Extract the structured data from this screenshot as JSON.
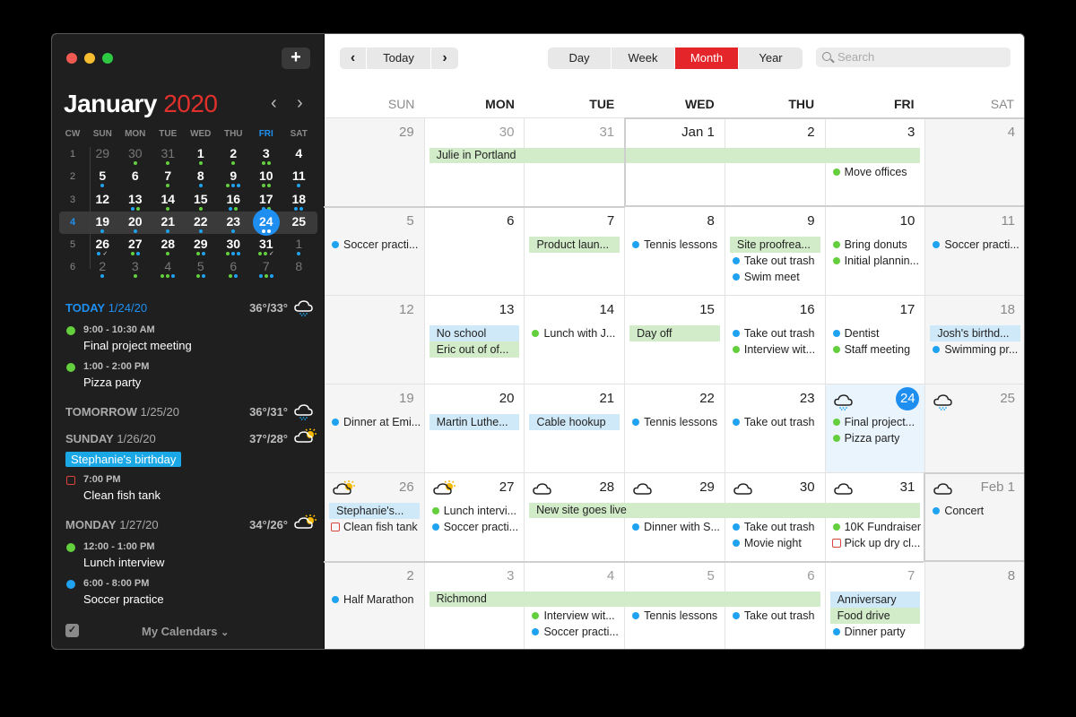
{
  "colors": {
    "green": "#63cf3d",
    "blue": "#1fa2ef",
    "red": "#e4262a",
    "accent": "#1e8ff0"
  },
  "sidebar": {
    "add_label": "+",
    "month": "January",
    "year": "2020",
    "prev": "‹",
    "next": "›",
    "mini_headers": [
      "CW",
      "SUN",
      "MON",
      "TUE",
      "WED",
      "THU",
      "FRI",
      "SAT"
    ],
    "mini_weeks": [
      {
        "cw": "1",
        "days": [
          {
            "n": "29",
            "dim": true,
            "dots": []
          },
          {
            "n": "30",
            "dim": true,
            "dots": [
              "g"
            ]
          },
          {
            "n": "31",
            "dim": true,
            "dots": [
              "g"
            ]
          },
          {
            "n": "1",
            "dots": [
              "g"
            ]
          },
          {
            "n": "2",
            "dots": [
              "g"
            ]
          },
          {
            "n": "3",
            "dots": [
              "g",
              "g"
            ]
          },
          {
            "n": "4",
            "dots": []
          }
        ]
      },
      {
        "cw": "2",
        "days": [
          {
            "n": "5",
            "dots": [
              "b"
            ]
          },
          {
            "n": "6",
            "dots": []
          },
          {
            "n": "7",
            "dots": [
              "g"
            ]
          },
          {
            "n": "8",
            "dots": [
              "b"
            ]
          },
          {
            "n": "9",
            "dots": [
              "g",
              "b",
              "b"
            ]
          },
          {
            "n": "10",
            "dots": [
              "g",
              "g"
            ]
          },
          {
            "n": "11",
            "dots": [
              "b"
            ]
          }
        ]
      },
      {
        "cw": "3",
        "days": [
          {
            "n": "12",
            "dots": []
          },
          {
            "n": "13",
            "dots": [
              "b",
              "g"
            ]
          },
          {
            "n": "14",
            "dots": [
              "g"
            ]
          },
          {
            "n": "15",
            "dots": [
              "g"
            ]
          },
          {
            "n": "16",
            "dots": [
              "b",
              "g"
            ]
          },
          {
            "n": "17",
            "dots": [
              "b",
              "g"
            ]
          },
          {
            "n": "18",
            "dots": [
              "b",
              "b"
            ]
          }
        ]
      },
      {
        "cw": "4",
        "current": true,
        "days": [
          {
            "n": "19",
            "dots": [
              "b"
            ]
          },
          {
            "n": "20",
            "dots": [
              "b"
            ]
          },
          {
            "n": "21",
            "dots": [
              "b"
            ]
          },
          {
            "n": "22",
            "dots": [
              "b"
            ]
          },
          {
            "n": "23",
            "dots": [
              "b"
            ]
          },
          {
            "n": "24",
            "today": true,
            "dots": [
              "w",
              "w"
            ]
          },
          {
            "n": "25",
            "dots": []
          }
        ]
      },
      {
        "cw": "5",
        "days": [
          {
            "n": "26",
            "dots": [
              "b",
              "c"
            ]
          },
          {
            "n": "27",
            "dots": [
              "g",
              "b"
            ]
          },
          {
            "n": "28",
            "dots": [
              "g"
            ]
          },
          {
            "n": "29",
            "dots": [
              "g",
              "b"
            ]
          },
          {
            "n": "30",
            "dots": [
              "g",
              "b",
              "b"
            ]
          },
          {
            "n": "31",
            "dots": [
              "g",
              "g",
              "c"
            ]
          },
          {
            "n": "1",
            "dim": true,
            "dots": [
              "b"
            ]
          }
        ]
      },
      {
        "cw": "6",
        "days": [
          {
            "n": "2",
            "dim": true,
            "dots": [
              "b"
            ]
          },
          {
            "n": "3",
            "dim": true,
            "dots": [
              "g"
            ]
          },
          {
            "n": "4",
            "dim": true,
            "dots": [
              "g",
              "g",
              "b"
            ]
          },
          {
            "n": "5",
            "dim": true,
            "dots": [
              "g",
              "b"
            ]
          },
          {
            "n": "6",
            "dim": true,
            "dots": [
              "g",
              "b"
            ]
          },
          {
            "n": "7",
            "dim": true,
            "dots": [
              "b",
              "g",
              "b"
            ]
          },
          {
            "n": "8",
            "dim": true,
            "dots": []
          }
        ]
      }
    ],
    "agenda": [
      {
        "label_bold": "TODAY",
        "label_date": "1/24/20",
        "today": true,
        "temp": "36°/33°",
        "weather": "rain-cloud-icon",
        "items": [
          {
            "type": "dot",
            "color": "green",
            "time": "9:00 - 10:30 AM",
            "title": "Final project meeting"
          },
          {
            "type": "dot",
            "color": "green",
            "time": "1:00 - 2:00 PM",
            "title": "Pizza party"
          }
        ]
      },
      {
        "label_bold": "TOMORROW",
        "label_date": "1/25/20",
        "temp": "36°/31°",
        "weather": "rain-cloud-icon",
        "items": []
      },
      {
        "label_bold": "SUNDAY",
        "label_date": "1/26/20",
        "temp": "37°/28°",
        "weather": "partly-sunny-icon",
        "allday": "Stephanie's birthday",
        "items": [
          {
            "type": "task",
            "time": "7:00 PM",
            "title": "Clean fish tank"
          }
        ]
      },
      {
        "label_bold": "MONDAY",
        "label_date": "1/27/20",
        "temp": "34°/26°",
        "weather": "partly-sunny-icon",
        "items": [
          {
            "type": "dot",
            "color": "green",
            "time": "12:00 - 1:00 PM",
            "title": "Lunch interview"
          },
          {
            "type": "dot",
            "color": "blue",
            "time": "6:00 - 8:00 PM",
            "title": "Soccer practice"
          }
        ]
      }
    ],
    "calendars_label": "My Calendars",
    "calendars_chevron": "⌄",
    "check": "✓"
  },
  "toolbar": {
    "prev": "‹",
    "today": "Today",
    "next": "›",
    "views": [
      "Day",
      "Week",
      "Month",
      "Year"
    ],
    "active_view": "Month",
    "search_placeholder": "Search"
  },
  "weekdays": [
    "SUN",
    "MON",
    "TUE",
    "WED",
    "THU",
    "FRI",
    "SAT"
  ],
  "weeks": [
    {
      "spans": [
        {
          "title": "Julie in Portland",
          "start": 1,
          "end": 5,
          "row": 0
        }
      ],
      "days": [
        {
          "num": "29",
          "out": true,
          "events": []
        },
        {
          "num": "30",
          "out": true,
          "events": [
            {
              "type": "gap"
            }
          ]
        },
        {
          "num": "31",
          "out": true,
          "events": [
            {
              "type": "gap"
            }
          ]
        },
        {
          "num": "Jan 1",
          "events": [
            {
              "type": "gap"
            }
          ]
        },
        {
          "num": "2",
          "events": [
            {
              "type": "gap"
            }
          ]
        },
        {
          "num": "3",
          "events": [
            {
              "type": "gap"
            },
            {
              "type": "dot",
              "color": "green",
              "title": "Move offices"
            }
          ]
        },
        {
          "num": "4",
          "events": []
        }
      ]
    },
    {
      "spans": [],
      "days": [
        {
          "num": "5",
          "events": [
            {
              "type": "dot",
              "color": "blue",
              "title": "Soccer practi..."
            }
          ]
        },
        {
          "num": "6",
          "events": []
        },
        {
          "num": "7",
          "events": [
            {
              "type": "bar",
              "color": "g",
              "title": "Product laun..."
            }
          ]
        },
        {
          "num": "8",
          "events": [
            {
              "type": "dot",
              "color": "blue",
              "title": "Tennis lessons"
            }
          ]
        },
        {
          "num": "9",
          "events": [
            {
              "type": "bar",
              "color": "g",
              "title": "Site proofrea..."
            },
            {
              "type": "dot",
              "color": "blue",
              "title": "Take out trash"
            },
            {
              "type": "dot",
              "color": "blue",
              "title": "Swim meet"
            }
          ]
        },
        {
          "num": "10",
          "events": [
            {
              "type": "dot",
              "color": "green",
              "title": "Bring donuts"
            },
            {
              "type": "dot",
              "color": "green",
              "title": "Initial plannin..."
            }
          ]
        },
        {
          "num": "11",
          "events": [
            {
              "type": "dot",
              "color": "blue",
              "title": "Soccer practi..."
            }
          ]
        }
      ]
    },
    {
      "spans": [],
      "days": [
        {
          "num": "12",
          "events": []
        },
        {
          "num": "13",
          "events": [
            {
              "type": "bar",
              "color": "b",
              "title": "No school"
            },
            {
              "type": "bar",
              "color": "g",
              "title": "Eric out of of..."
            }
          ]
        },
        {
          "num": "14",
          "events": [
            {
              "type": "dot",
              "color": "green",
              "title": "Lunch with J..."
            }
          ]
        },
        {
          "num": "15",
          "events": [
            {
              "type": "bar",
              "color": "g",
              "title": "Day off"
            }
          ]
        },
        {
          "num": "16",
          "events": [
            {
              "type": "dot",
              "color": "blue",
              "title": "Take out trash"
            },
            {
              "type": "dot",
              "color": "green",
              "title": "Interview wit..."
            }
          ]
        },
        {
          "num": "17",
          "events": [
            {
              "type": "dot",
              "color": "blue",
              "title": "Dentist"
            },
            {
              "type": "dot",
              "color": "green",
              "title": "Staff meeting"
            }
          ]
        },
        {
          "num": "18",
          "events": [
            {
              "type": "bar",
              "color": "b",
              "title": "Josh's birthd..."
            },
            {
              "type": "dot",
              "color": "blue",
              "title": "Swimming pr..."
            }
          ]
        }
      ]
    },
    {
      "spans": [],
      "days": [
        {
          "num": "19",
          "events": [
            {
              "type": "dot",
              "color": "blue",
              "title": "Dinner at Emi..."
            }
          ]
        },
        {
          "num": "20",
          "events": [
            {
              "type": "bar",
              "color": "b",
              "title": "Martin Luthe..."
            }
          ]
        },
        {
          "num": "21",
          "events": [
            {
              "type": "bar",
              "color": "b",
              "title": "Cable hookup"
            }
          ]
        },
        {
          "num": "22",
          "events": [
            {
              "type": "dot",
              "color": "blue",
              "title": "Tennis lessons"
            }
          ]
        },
        {
          "num": "23",
          "events": [
            {
              "type": "dot",
              "color": "blue",
              "title": "Take out trash"
            }
          ]
        },
        {
          "num": "24",
          "today": true,
          "weather": "rain-cloud-icon",
          "events": [
            {
              "type": "dot",
              "color": "green",
              "title": "Final project..."
            },
            {
              "type": "dot",
              "color": "green",
              "title": "Pizza party"
            }
          ]
        },
        {
          "num": "25",
          "weather": "rain-cloud-icon",
          "events": []
        }
      ]
    },
    {
      "spans": [
        {
          "title": "New site goes live",
          "start": 2,
          "end": 5,
          "row": 0
        }
      ],
      "days": [
        {
          "num": "26",
          "weather": "partly-sunny-icon",
          "events": [
            {
              "type": "bar",
              "color": "b",
              "title": "Stephanie's..."
            },
            {
              "type": "task",
              "title": "Clean fish tank"
            }
          ]
        },
        {
          "num": "27",
          "weather": "partly-sunny-icon",
          "events": [
            {
              "type": "dot",
              "color": "green",
              "title": "Lunch intervi..."
            },
            {
              "type": "dot",
              "color": "blue",
              "title": "Soccer practi..."
            }
          ]
        },
        {
          "num": "28",
          "weather": "cloud-icon",
          "events": [
            {
              "type": "gap"
            }
          ]
        },
        {
          "num": "29",
          "weather": "cloud-icon",
          "events": [
            {
              "type": "gap"
            },
            {
              "type": "dot",
              "color": "blue",
              "title": "Dinner with S..."
            }
          ]
        },
        {
          "num": "30",
          "weather": "cloud-icon",
          "events": [
            {
              "type": "gap"
            },
            {
              "type": "dot",
              "color": "blue",
              "title": "Take out trash"
            },
            {
              "type": "dot",
              "color": "blue",
              "title": "Movie night"
            }
          ]
        },
        {
          "num": "31",
          "weather": "cloud-icon",
          "events": [
            {
              "type": "gap"
            },
            {
              "type": "dot",
              "color": "green",
              "title": "10K Fundraiser"
            },
            {
              "type": "task",
              "title": "Pick up dry cl..."
            }
          ]
        },
        {
          "num": "Feb 1",
          "out": true,
          "weather": "cloud-icon",
          "events": [
            {
              "type": "dot",
              "color": "blue",
              "title": "Concert"
            }
          ]
        }
      ]
    },
    {
      "spans": [
        {
          "title": "Richmond",
          "start": 1,
          "end": 4,
          "row": 0
        }
      ],
      "days": [
        {
          "num": "2",
          "out": true,
          "events": [
            {
              "type": "dot",
              "color": "blue",
              "title": "Half Marathon"
            }
          ]
        },
        {
          "num": "3",
          "out": true,
          "events": [
            {
              "type": "gap"
            }
          ]
        },
        {
          "num": "4",
          "out": true,
          "events": [
            {
              "type": "gap"
            },
            {
              "type": "dot",
              "color": "green",
              "title": "Interview wit..."
            },
            {
              "type": "dot",
              "color": "blue",
              "title": "Soccer practi..."
            }
          ]
        },
        {
          "num": "5",
          "out": true,
          "events": [
            {
              "type": "gap"
            },
            {
              "type": "dot",
              "color": "blue",
              "title": "Tennis lessons"
            }
          ]
        },
        {
          "num": "6",
          "out": true,
          "events": [
            {
              "type": "gap"
            },
            {
              "type": "dot",
              "color": "blue",
              "title": "Take out trash"
            }
          ]
        },
        {
          "num": "7",
          "out": true,
          "events": [
            {
              "type": "bar",
              "color": "b",
              "title": "Anniversary"
            },
            {
              "type": "bar",
              "color": "g",
              "title": "Food drive"
            },
            {
              "type": "dot",
              "color": "blue",
              "title": "Dinner party"
            }
          ]
        },
        {
          "num": "8",
          "out": true,
          "events": []
        }
      ]
    }
  ]
}
